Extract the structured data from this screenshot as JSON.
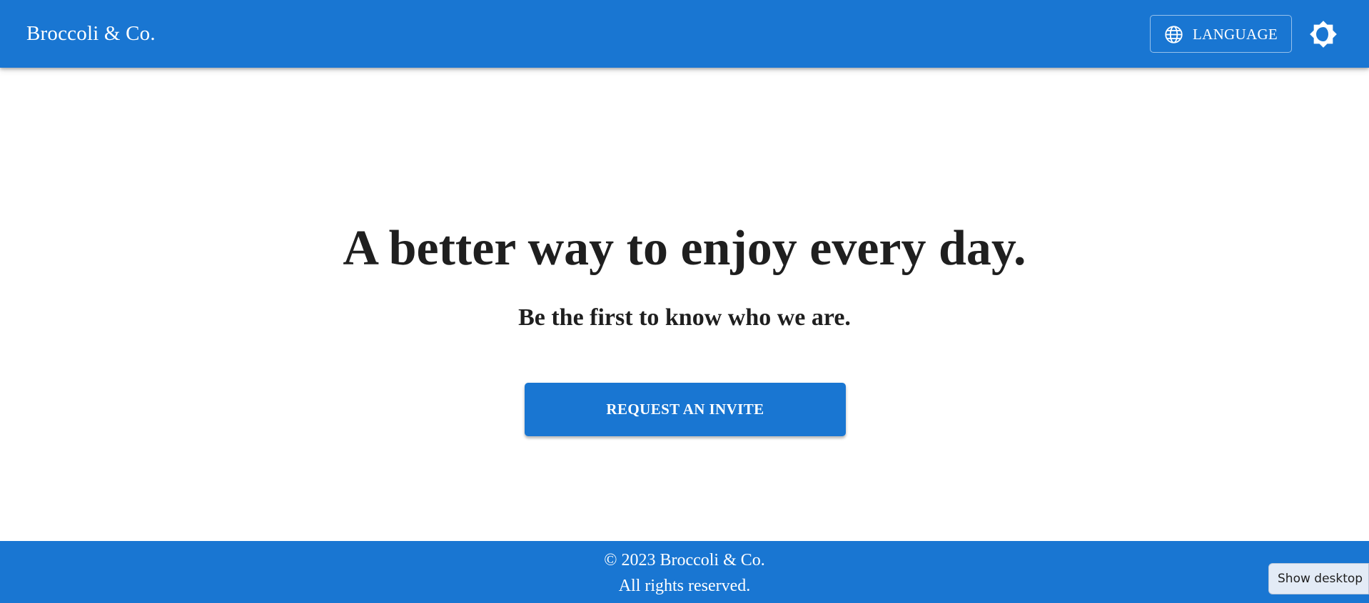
{
  "header": {
    "brand": "Broccoli & Co.",
    "language_button_label": "LANGUAGE",
    "language_icon": "globe-icon",
    "theme_toggle_icon": "brightness-icon"
  },
  "hero": {
    "headline": "A better way to enjoy every day.",
    "subheadline": "Be the first to know who we are.",
    "cta_label": "REQUEST AN INVITE"
  },
  "footer": {
    "copyright": "© 2023 Broccoli & Co.",
    "rights": "All rights reserved."
  },
  "overlay": {
    "show_desktop_label": "Show desktop"
  },
  "colors": {
    "primary": "#1976d2",
    "text": "#1f1f1f",
    "background": "#ffffff"
  }
}
